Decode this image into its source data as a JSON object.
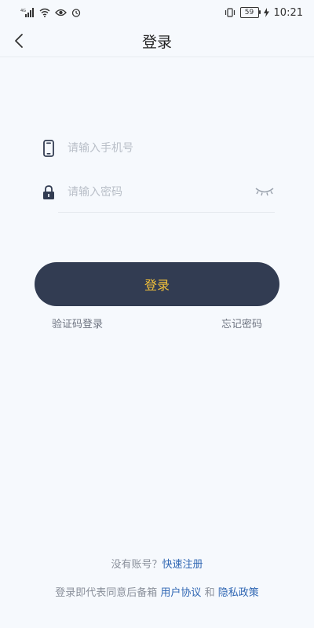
{
  "status_bar": {
    "network_label": "4G",
    "battery_level": "59",
    "time": "10:21"
  },
  "header": {
    "title": "登录"
  },
  "form": {
    "phone_placeholder": "请输入手机号",
    "password_placeholder": "请输入密码"
  },
  "actions": {
    "login_label": "登录",
    "sms_login_label": "验证码登录",
    "forgot_password_label": "忘记密码"
  },
  "footer": {
    "no_account_text": "没有账号？",
    "register_link": "快速注册",
    "agreement_prefix": "登录即代表同意后备箱",
    "user_agreement_link": "用户协议",
    "and_text": "和",
    "privacy_link": "隐私政策"
  },
  "colors": {
    "background": "#f6f9fd",
    "button_bg": "#323c52",
    "button_text": "#f1c03a",
    "link": "#2f66b3"
  }
}
